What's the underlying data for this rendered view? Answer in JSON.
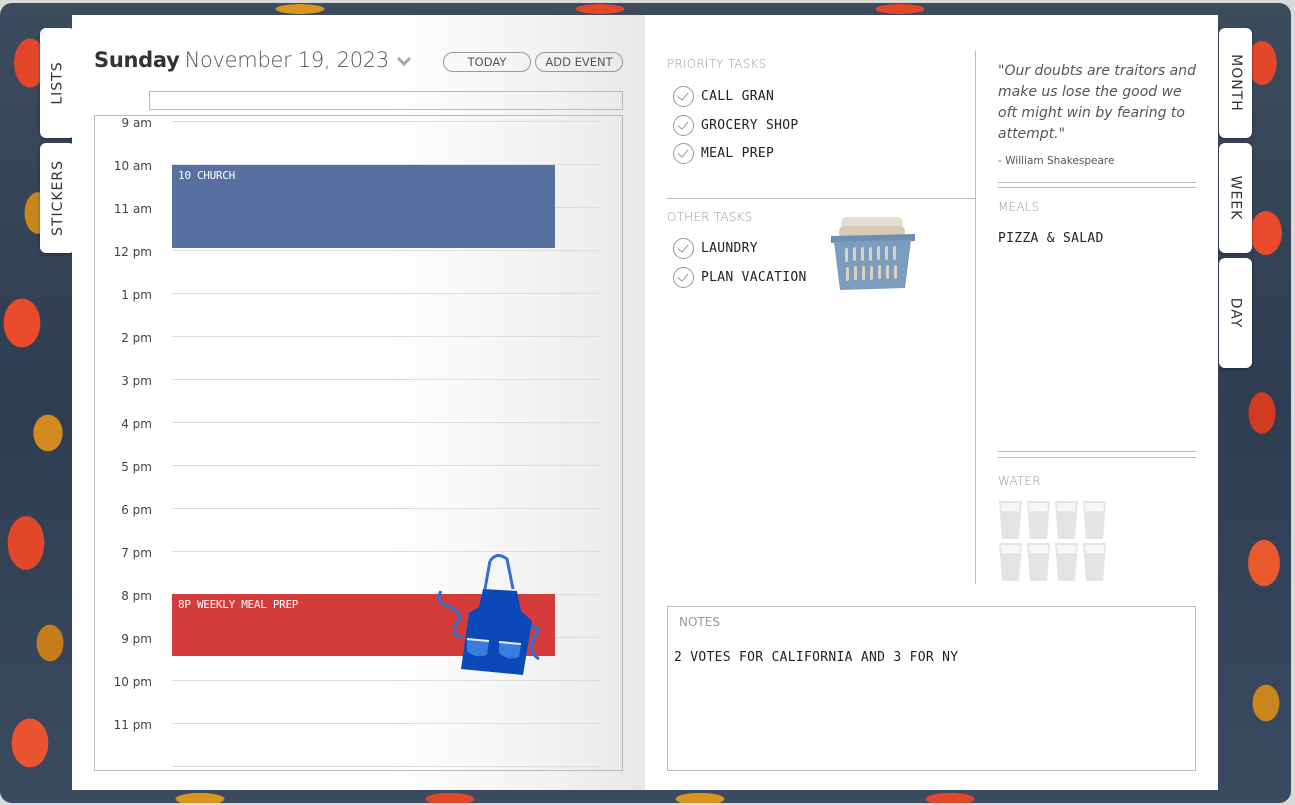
{
  "left_tabs": [
    {
      "label": "LISTS"
    },
    {
      "label": "STICKERS"
    }
  ],
  "right_tabs": [
    {
      "label": "MONTH"
    },
    {
      "label": "WEEK"
    },
    {
      "label": "DAY"
    }
  ],
  "header": {
    "day_name": "Sunday",
    "date": "November 19, 2023",
    "today_label": "TODAY",
    "add_event_label": "ADD EVENT",
    "all_day_value": ""
  },
  "timeline": {
    "hours": [
      "9 am",
      "10 am",
      "11 am",
      "12 pm",
      "1 pm",
      "2 pm",
      "3 pm",
      "4 pm",
      "5 pm",
      "6 pm",
      "7 pm",
      "8 pm",
      "9 pm",
      "10 pm",
      "11 pm"
    ],
    "events": [
      {
        "title": "10 church",
        "color": "#5870a0",
        "start": "10 am",
        "end": "12 pm"
      },
      {
        "title": "8p weekly meal prep",
        "color": "#d43c3c",
        "start": "8 pm",
        "end": "9:30 pm",
        "sticker": "apron-icon"
      }
    ]
  },
  "priority_tasks": {
    "label": "PRIORITY TASKS",
    "items": [
      "CALL GRAN",
      "GROCERY SHOP",
      "MEAL PREP"
    ]
  },
  "other_tasks": {
    "label": "OTHER TASKS",
    "items": [
      "LAUNDRY",
      "PLAN VACATION"
    ],
    "sticker": "laundry-basket-icon"
  },
  "quote": {
    "text": "\"Our doubts are traitors and make us lose the good we oft might win by fearing to attempt.\"",
    "author": "- William Shakespeare"
  },
  "meals": {
    "label": "MEALS",
    "value": "PIZZA & SALAD"
  },
  "water": {
    "label": "WATER",
    "glasses_total": 8,
    "glasses_filled": 0
  },
  "notes": {
    "label": "NOTES",
    "value": "2 VOTES FOR CALIFORNIA AND 3 FOR NY"
  },
  "colors": {
    "church_event": "#5870a0",
    "meal_event": "#d43c3c",
    "apron": "#0b49b8",
    "basket": "#6d8fb3"
  }
}
